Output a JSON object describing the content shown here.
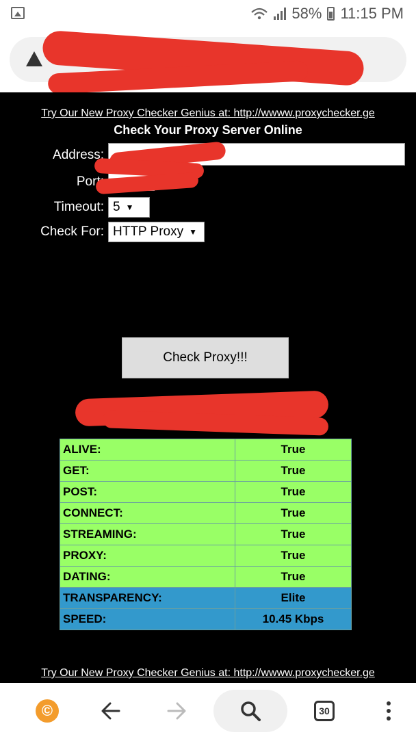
{
  "status_bar": {
    "battery": "58%",
    "time": "11:15 PM"
  },
  "page": {
    "promo_link": "Try Our New Proxy Checker Genius at: http://wwww.proxychecker.ge",
    "heading": "Check Your Proxy Server Online",
    "form": {
      "address_label": "Address:",
      "port_label": "Port:",
      "timeout_label": "Timeout:",
      "timeout_value": "5",
      "check_for_label": "Check For:",
      "check_for_value": "HTTP Proxy"
    },
    "check_button": "Check Proxy!!!",
    "results": [
      {
        "label": "ALIVE:",
        "value": "True",
        "status": "green"
      },
      {
        "label": "GET:",
        "value": "True",
        "status": "green"
      },
      {
        "label": "POST:",
        "value": "True",
        "status": "green"
      },
      {
        "label": "CONNECT:",
        "value": "True",
        "status": "green"
      },
      {
        "label": "STREAMING:",
        "value": "True",
        "status": "green"
      },
      {
        "label": "PROXY:",
        "value": "True",
        "status": "green"
      },
      {
        "label": "DATING:",
        "value": "True",
        "status": "green"
      },
      {
        "label": "TRANSPARENCY:",
        "value": "Elite",
        "status": "blue"
      },
      {
        "label": "SPEED:",
        "value": "10.45 Kbps",
        "status": "blue"
      }
    ]
  },
  "nav_bar": {
    "tabs_count": "30"
  },
  "icons": {
    "status_left": "image-icon",
    "wifi": "wifi-icon",
    "signal": "signal-icon",
    "battery": "battery-icon",
    "url_warning": "warning-icon",
    "nav": [
      "brave-coin-icon",
      "back-arrow-icon",
      "forward-arrow-icon",
      "search-icon",
      "tabs-icon",
      "more-options-icon"
    ]
  },
  "colors": {
    "page_background": "#000000",
    "result_true": "#99ff66",
    "result_info": "#3399cc",
    "redaction": "#e8352b"
  }
}
